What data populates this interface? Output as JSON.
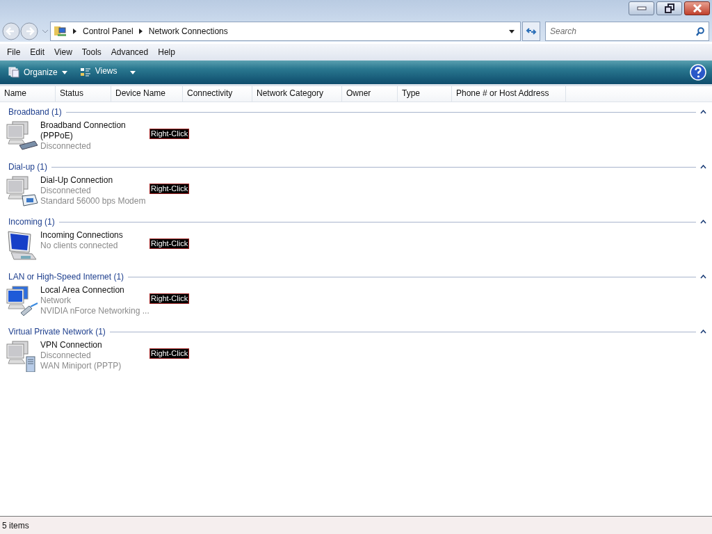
{
  "address": {
    "crumbs": [
      "Control Panel",
      "Network Connections"
    ]
  },
  "search": {
    "placeholder": "Search"
  },
  "menu": [
    "File",
    "Edit",
    "View",
    "Tools",
    "Advanced",
    "Help"
  ],
  "toolbar": [
    {
      "label": "Organize",
      "kind": "organize"
    },
    {
      "label": "Views",
      "kind": "views"
    }
  ],
  "columns": [
    "Name",
    "Status",
    "Device Name",
    "Connectivity",
    "Network Category",
    "Owner",
    "Type",
    "Phone # or Host Address"
  ],
  "groups": [
    {
      "title": "Broadband (1)",
      "expanded": true,
      "items": [
        {
          "kind": "broadband",
          "name": "Broadband Connection (PPPoE)",
          "details": [
            "Disconnected"
          ],
          "annotation": "Right-Click"
        }
      ]
    },
    {
      "title": "Dial-up (1)",
      "expanded": true,
      "items": [
        {
          "kind": "dialup",
          "name": "Dial-Up Connection",
          "details": [
            "Disconnected",
            "Standard 56000 bps Modem"
          ],
          "annotation": "Right-Click"
        }
      ]
    },
    {
      "title": "Incoming (1)",
      "expanded": true,
      "items": [
        {
          "kind": "incoming",
          "name": "Incoming Connections",
          "details": [
            "No clients connected"
          ],
          "annotation": "Right-Click"
        }
      ]
    },
    {
      "title": "LAN or High-Speed Internet (1)",
      "expanded": true,
      "items": [
        {
          "kind": "lan",
          "name": "Local Area Connection",
          "details": [
            "Network",
            "NVIDIA nForce Networking ..."
          ],
          "annotation": "Right-Click"
        }
      ]
    },
    {
      "title": "Virtual Private Network (1)",
      "expanded": true,
      "items": [
        {
          "kind": "vpn",
          "name": "VPN Connection",
          "details": [
            "Disconnected",
            "WAN Miniport (PPTP)"
          ],
          "annotation": "Right-Click"
        }
      ]
    }
  ],
  "status_bar": "5 items"
}
